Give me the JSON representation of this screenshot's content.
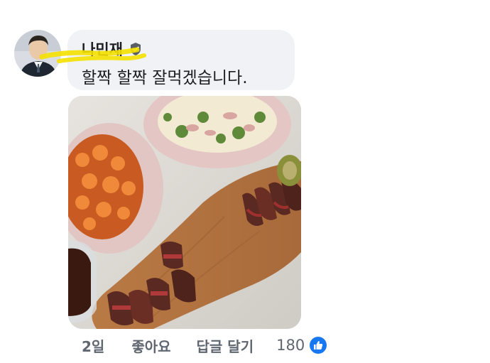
{
  "comment": {
    "author": "나민재",
    "text": "할짝 할짝 잘먹겠습니다.",
    "time": "2일",
    "like_label": "좋아요",
    "reply_label": "답글 달기",
    "reaction_count": "180"
  },
  "icons": {
    "verified": "verified-badge-icon",
    "reaction": "like-reaction-icon"
  },
  "colors": {
    "bubble": "#f0f2f5",
    "meta_text": "#606770",
    "like_blue": "#1877f2",
    "highlight": "#f4e100"
  }
}
